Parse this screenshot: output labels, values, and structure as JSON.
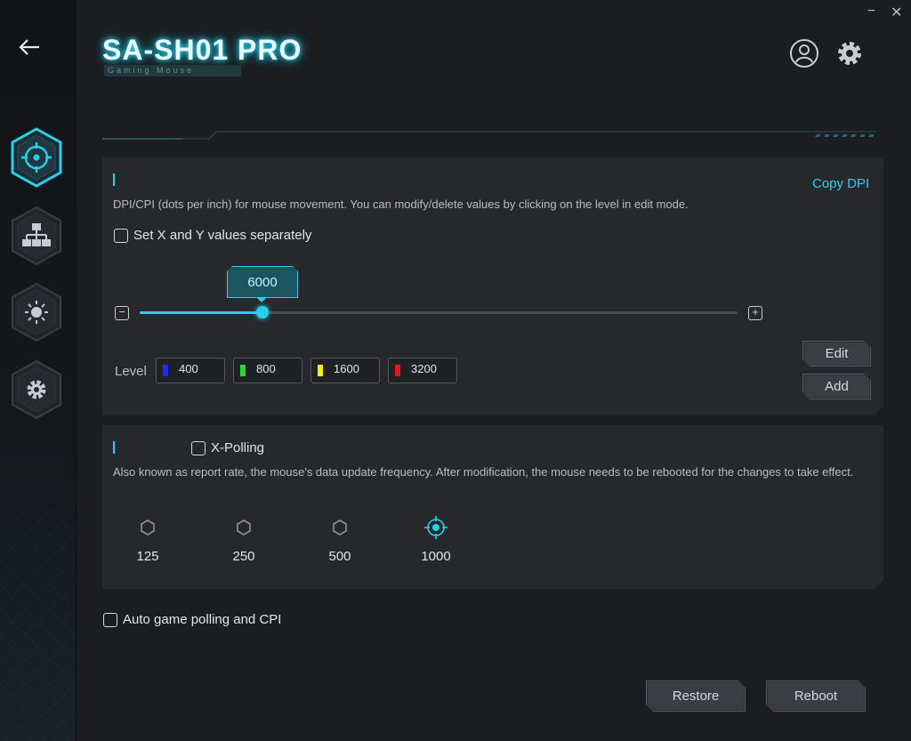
{
  "window": {
    "minimize_glyph": "−",
    "close_glyph": "✕"
  },
  "header": {
    "title": "SA-SH01 PRO",
    "subtitle": "Gaming Mouse"
  },
  "sidebar": {
    "items": [
      {
        "name": "performance",
        "icon": "crosshair-icon",
        "active": true
      },
      {
        "name": "buttons",
        "icon": "hierarchy-icon",
        "active": false
      },
      {
        "name": "lighting",
        "icon": "sun-icon",
        "active": false
      },
      {
        "name": "settings",
        "icon": "gear-icon",
        "active": false
      }
    ]
  },
  "dpi": {
    "description": "DPI/CPI (dots per inch) for mouse movement. You can modify/delete values by clicking on the level in edit mode.",
    "copy_label": "Copy DPI",
    "separate_xy_label": "Set X and Y values separately",
    "current_value": "6000",
    "slider_fraction": 0.205,
    "minus_glyph": "−",
    "plus_glyph": "+",
    "level_label": "Level",
    "levels": [
      {
        "value": "400",
        "color": "#1a2cff"
      },
      {
        "value": "800",
        "color": "#22e02a"
      },
      {
        "value": "1600",
        "color": "#f4ee13"
      },
      {
        "value": "3200",
        "color": "#e8161c"
      }
    ],
    "edit_label": "Edit",
    "add_label": "Add"
  },
  "polling": {
    "x_polling_label": "X-Polling",
    "description": "Also known as report rate, the mouse's data update frequency. After modification, the mouse needs to be rebooted for the changes to take effect.",
    "rates": [
      "125",
      "250",
      "500",
      "1000"
    ],
    "selected_rate": "1000"
  },
  "auto_game_label": "Auto game polling and CPI",
  "footer": {
    "restore_label": "Restore",
    "reboot_label": "Reboot"
  },
  "colors": {
    "accent": "#29d0ee",
    "panel": "#26282c",
    "background": "#1b1d20"
  }
}
